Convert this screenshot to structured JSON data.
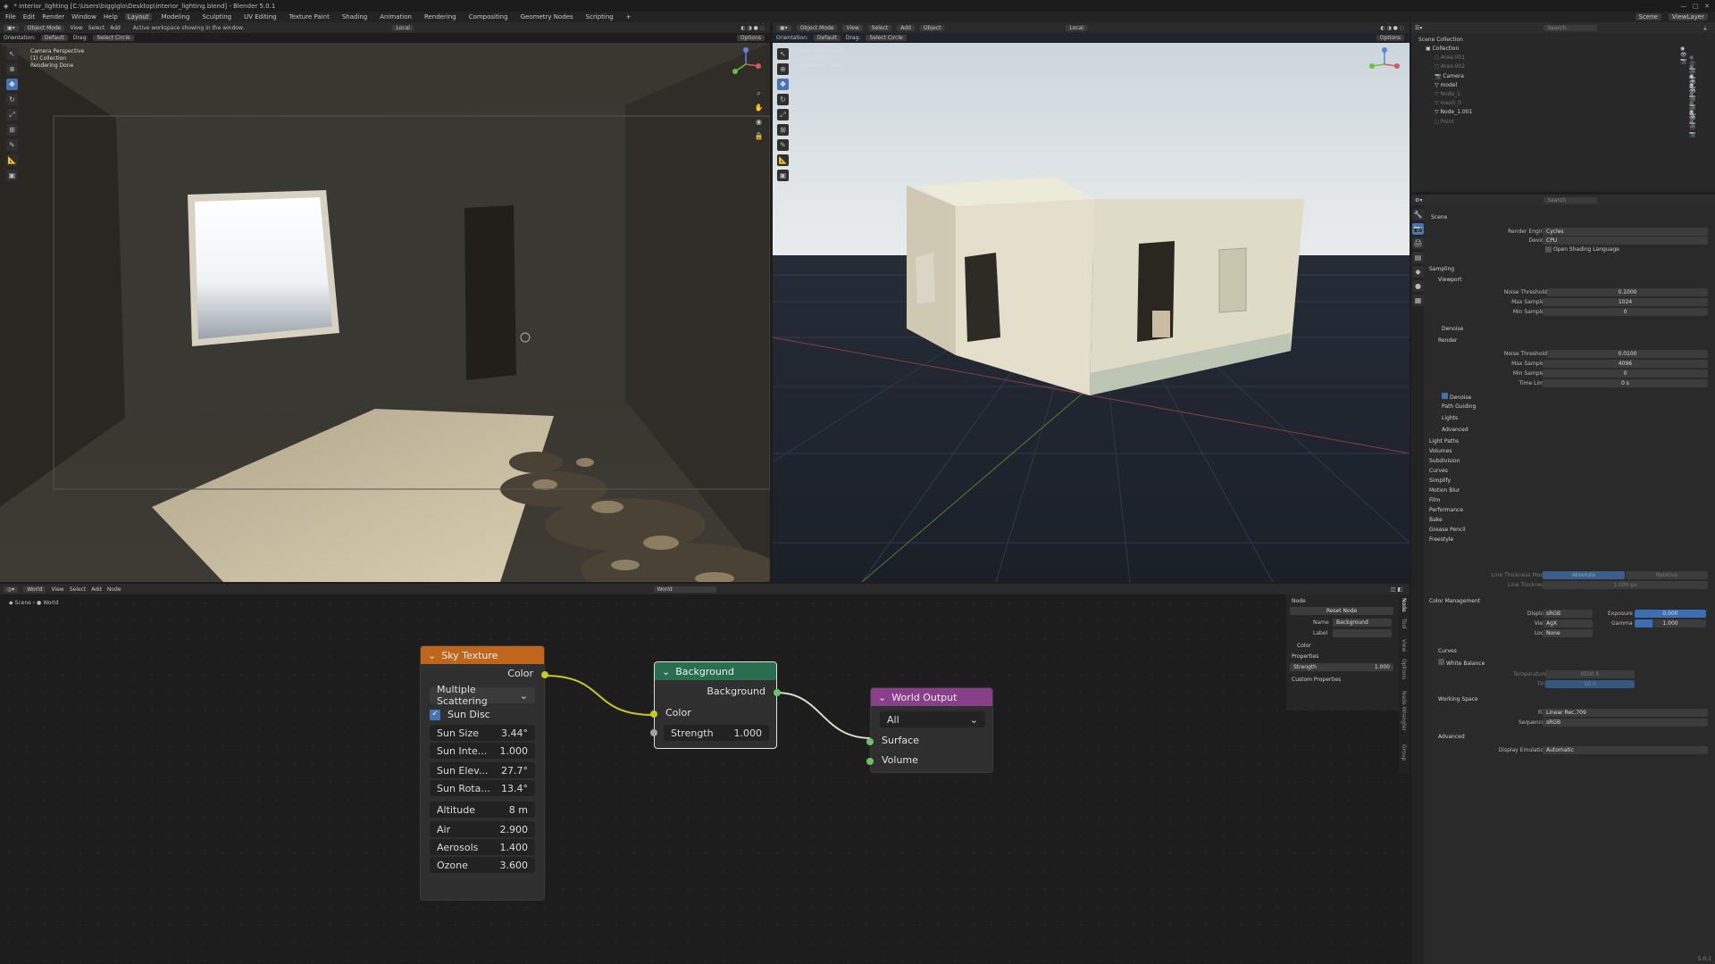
{
  "window": {
    "title": "* interior_lighting [C:\\Users\\biggiglo\\Desktop\\interior_lighting.blend] - Blender 5.0.1"
  },
  "menu": [
    "File",
    "Edit",
    "Render",
    "Window",
    "Help"
  ],
  "workspaces": [
    "Layout",
    "Modeling",
    "Sculpting",
    "UV Editing",
    "Texture Paint",
    "Shading",
    "Animation",
    "Rendering",
    "Compositing",
    "Geometry Nodes",
    "Scripting"
  ],
  "scene": {
    "label": "Scene",
    "viewlayer": "ViewLayer",
    "search_placeholder": "Search"
  },
  "vp1": {
    "mode": "Object Mode",
    "view": "View",
    "select": "Select",
    "add": "Add",
    "status": "Active workspace showing in the window.",
    "orientation_label": "Orientation:",
    "orientation": "Default",
    "drag_label": "Drag:",
    "drag": "Select Circle",
    "options": "Options",
    "local": "Local",
    "overlay": [
      "Camera Perspective",
      "(1) Collection",
      "Rendering Done"
    ]
  },
  "vp2": {
    "mode": "Object Mode",
    "menus": [
      "View",
      "Select",
      "Add",
      "Object"
    ],
    "local": "Local",
    "orientation_label": "Orientation:",
    "orientation": "Default",
    "drag_label": "Drag:",
    "drag": "Select Circle",
    "options": "Options",
    "overlay": [
      "User Perspective",
      "(1) Collection",
      "Rendering Done"
    ]
  },
  "outliner": {
    "title": "Scene Collection",
    "items": [
      {
        "name": "Collection",
        "dim": false
      },
      {
        "name": "Area.001",
        "dim": true
      },
      {
        "name": "Area.002",
        "dim": true
      },
      {
        "name": "Camera",
        "dim": false
      },
      {
        "name": "model",
        "dim": false
      },
      {
        "name": "Node_1",
        "dim": true
      },
      {
        "name": "mesh_0",
        "dim": true
      },
      {
        "name": "Node_1.001",
        "dim": false
      },
      {
        "name": "Point",
        "dim": true
      }
    ]
  },
  "props": {
    "scene": "Scene",
    "render_engine_label": "Render Engine",
    "render_engine": "Cycles",
    "device_label": "Device",
    "device": "CPU",
    "osl": "Open Shading Language",
    "sampling": "Sampling",
    "viewport": "Viewport",
    "noise_threshold_label": "Noise Threshold",
    "vp_noise": "0.1000",
    "max_samples_label": "Max Samples",
    "vp_max": "1024",
    "min_samples_label": "Min Samples",
    "vp_min": "0",
    "denoise": "Denoise",
    "render": "Render",
    "r_noise": "0.0100",
    "r_max": "4096",
    "r_min": "0",
    "time_limit_label": "Time Limit",
    "time_limit": "0 s",
    "path_guiding": "Path Guiding",
    "lights": "Lights",
    "advanced": "Advanced",
    "sections": [
      "Light Paths",
      "Volumes",
      "Subdivision",
      "Curves",
      "Simplify",
      "Motion Blur",
      "Film",
      "Performance",
      "Bake",
      "Grease Pencil",
      "Freestyle"
    ],
    "line_thickness_mode_label": "Line Thickness Mode",
    "absolute": "Absolute",
    "relative": "Relative",
    "line_thickness_label": "Line Thickness",
    "line_thickness": "1.000 px",
    "color_management": "Color Management",
    "display_label": "Display",
    "display": "sRGB",
    "view_label": "View",
    "view": "AgX",
    "look_label": "Look",
    "look": "None",
    "exposure_label": "Exposure",
    "exposure": "0.000",
    "gamma_label": "Gamma",
    "gamma": "1.000",
    "curves": "Curves",
    "white_balance": "White Balance",
    "temperature_label": "Temperature",
    "temperature": "6500 K",
    "tint_label": "Tint",
    "tint": "10.0",
    "working_space": "Working Space",
    "file_label": "File",
    "file": "Linear Rec.709",
    "sequencer_label": "Sequencer",
    "sequencer": "sRGB",
    "display_emulation_label": "Display Emulation",
    "display_emulation": "Automatic"
  },
  "node_editor": {
    "type": "World",
    "menus": [
      "View",
      "Select",
      "Add",
      "Node"
    ],
    "world": "World",
    "breadcrumb": [
      "Scene",
      "World"
    ],
    "panel": {
      "node": "Node",
      "reset": "Reset Node",
      "name_label": "Name",
      "name": "Background",
      "label_label": "Label",
      "color": "Color",
      "properties": "Properties",
      "strength_label": "Strength",
      "strength": "1.000",
      "custom": "Custom Properties"
    },
    "tabs": [
      "Node",
      "Tool",
      "View",
      "Options",
      "Node Wrangler",
      "Group"
    ]
  },
  "sky": {
    "title": "Sky Texture",
    "out": "Color",
    "type": "Multiple Scattering",
    "sun_disc": "Sun Disc",
    "fields": [
      {
        "label": "Sun Size",
        "value": "3.44°"
      },
      {
        "label": "Sun Inte...",
        "value": "1.000"
      },
      {
        "label": "Sun Elev...",
        "value": "27.7°"
      },
      {
        "label": "Sun Rota...",
        "value": "13.4°"
      },
      {
        "label": "Altitude",
        "value": "8 m"
      },
      {
        "label": "Air",
        "value": "2.900"
      },
      {
        "label": "Aerosols",
        "value": "1.400"
      },
      {
        "label": "Ozone",
        "value": "3.600"
      }
    ]
  },
  "bg": {
    "title": "Background",
    "out": "Background",
    "in_color": "Color",
    "strength_label": "Strength",
    "strength": "1.000"
  },
  "wo": {
    "title": "World Output",
    "target": "All",
    "surface": "Surface",
    "volume": "Volume"
  },
  "version": "5.0.1",
  "colors": {
    "accent": "#4772b3",
    "sky_header": "#c0661c",
    "bg_header": "#2a6e50",
    "wo_header": "#8a3f8a"
  }
}
